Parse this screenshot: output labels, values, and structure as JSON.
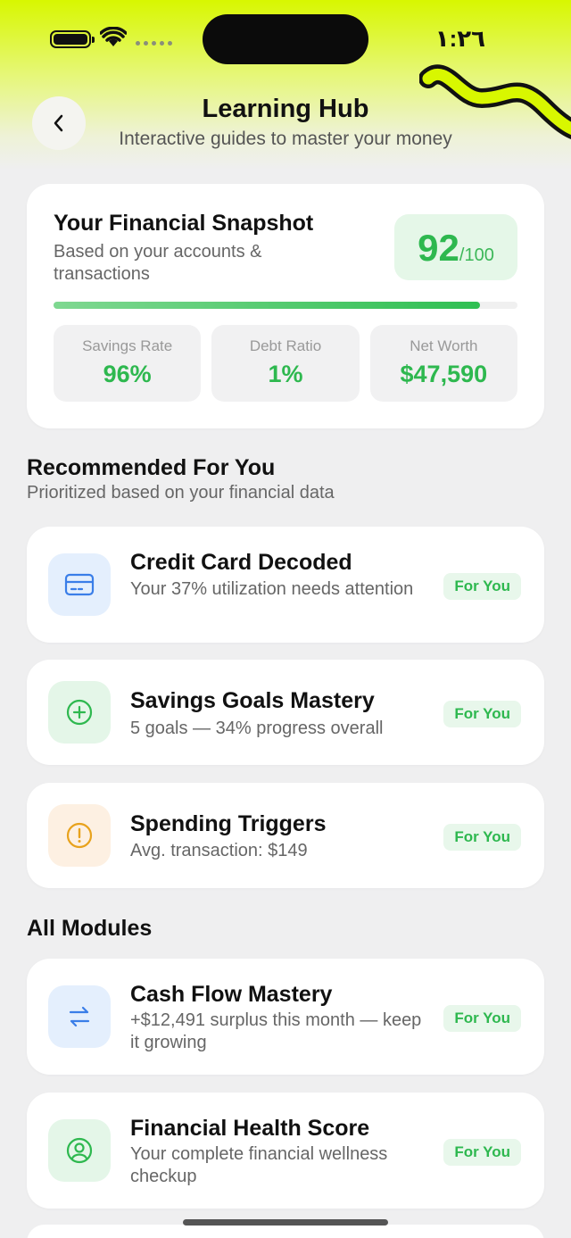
{
  "status": {
    "time": "١:٢٦"
  },
  "header": {
    "title": "Learning Hub",
    "subtitle": "Interactive guides to master your money",
    "accent": "#d8f700"
  },
  "snapshot": {
    "title": "Your Financial Snapshot",
    "subtitle": "Based on your accounts & transactions",
    "score": "92",
    "score_max": "/100",
    "progress": 0.92,
    "metrics": [
      {
        "label": "Savings Rate",
        "value": "96%"
      },
      {
        "label": "Debt Ratio",
        "value": "1%"
      },
      {
        "label": "Net Worth",
        "value": "$47,590"
      }
    ]
  },
  "recommended": {
    "title": "Recommended For You",
    "subtitle": "Prioritized based on your financial data",
    "items": [
      {
        "title": "Credit Card Decoded",
        "desc": "Your 37% utilization needs attention",
        "badge": "For You",
        "icon": "credit-card-icon",
        "icon_color": "#3a7ee8"
      },
      {
        "title": "Savings Goals Mastery",
        "desc": "5 goals — 34% progress overall",
        "badge": "For You",
        "icon": "plus-circle-icon",
        "icon_color": "#2eb84f"
      },
      {
        "title": "Spending Triggers",
        "desc": "Avg. transaction: $149",
        "badge": "For You",
        "icon": "alert-circle-icon",
        "icon_color": "#e8a21c"
      }
    ]
  },
  "all_modules": {
    "title": "All Modules",
    "items": [
      {
        "title": "Cash Flow Mastery",
        "desc": "+$12,491 surplus this month — keep it growing",
        "badge": "For You",
        "icon": "transfer-arrows-icon",
        "icon_color": "#3a7ee8"
      },
      {
        "title": "Financial Health Score",
        "desc": "Your complete financial wellness checkup",
        "badge": "For You",
        "icon": "user-circle-icon",
        "icon_color": "#2eb84f"
      }
    ]
  }
}
